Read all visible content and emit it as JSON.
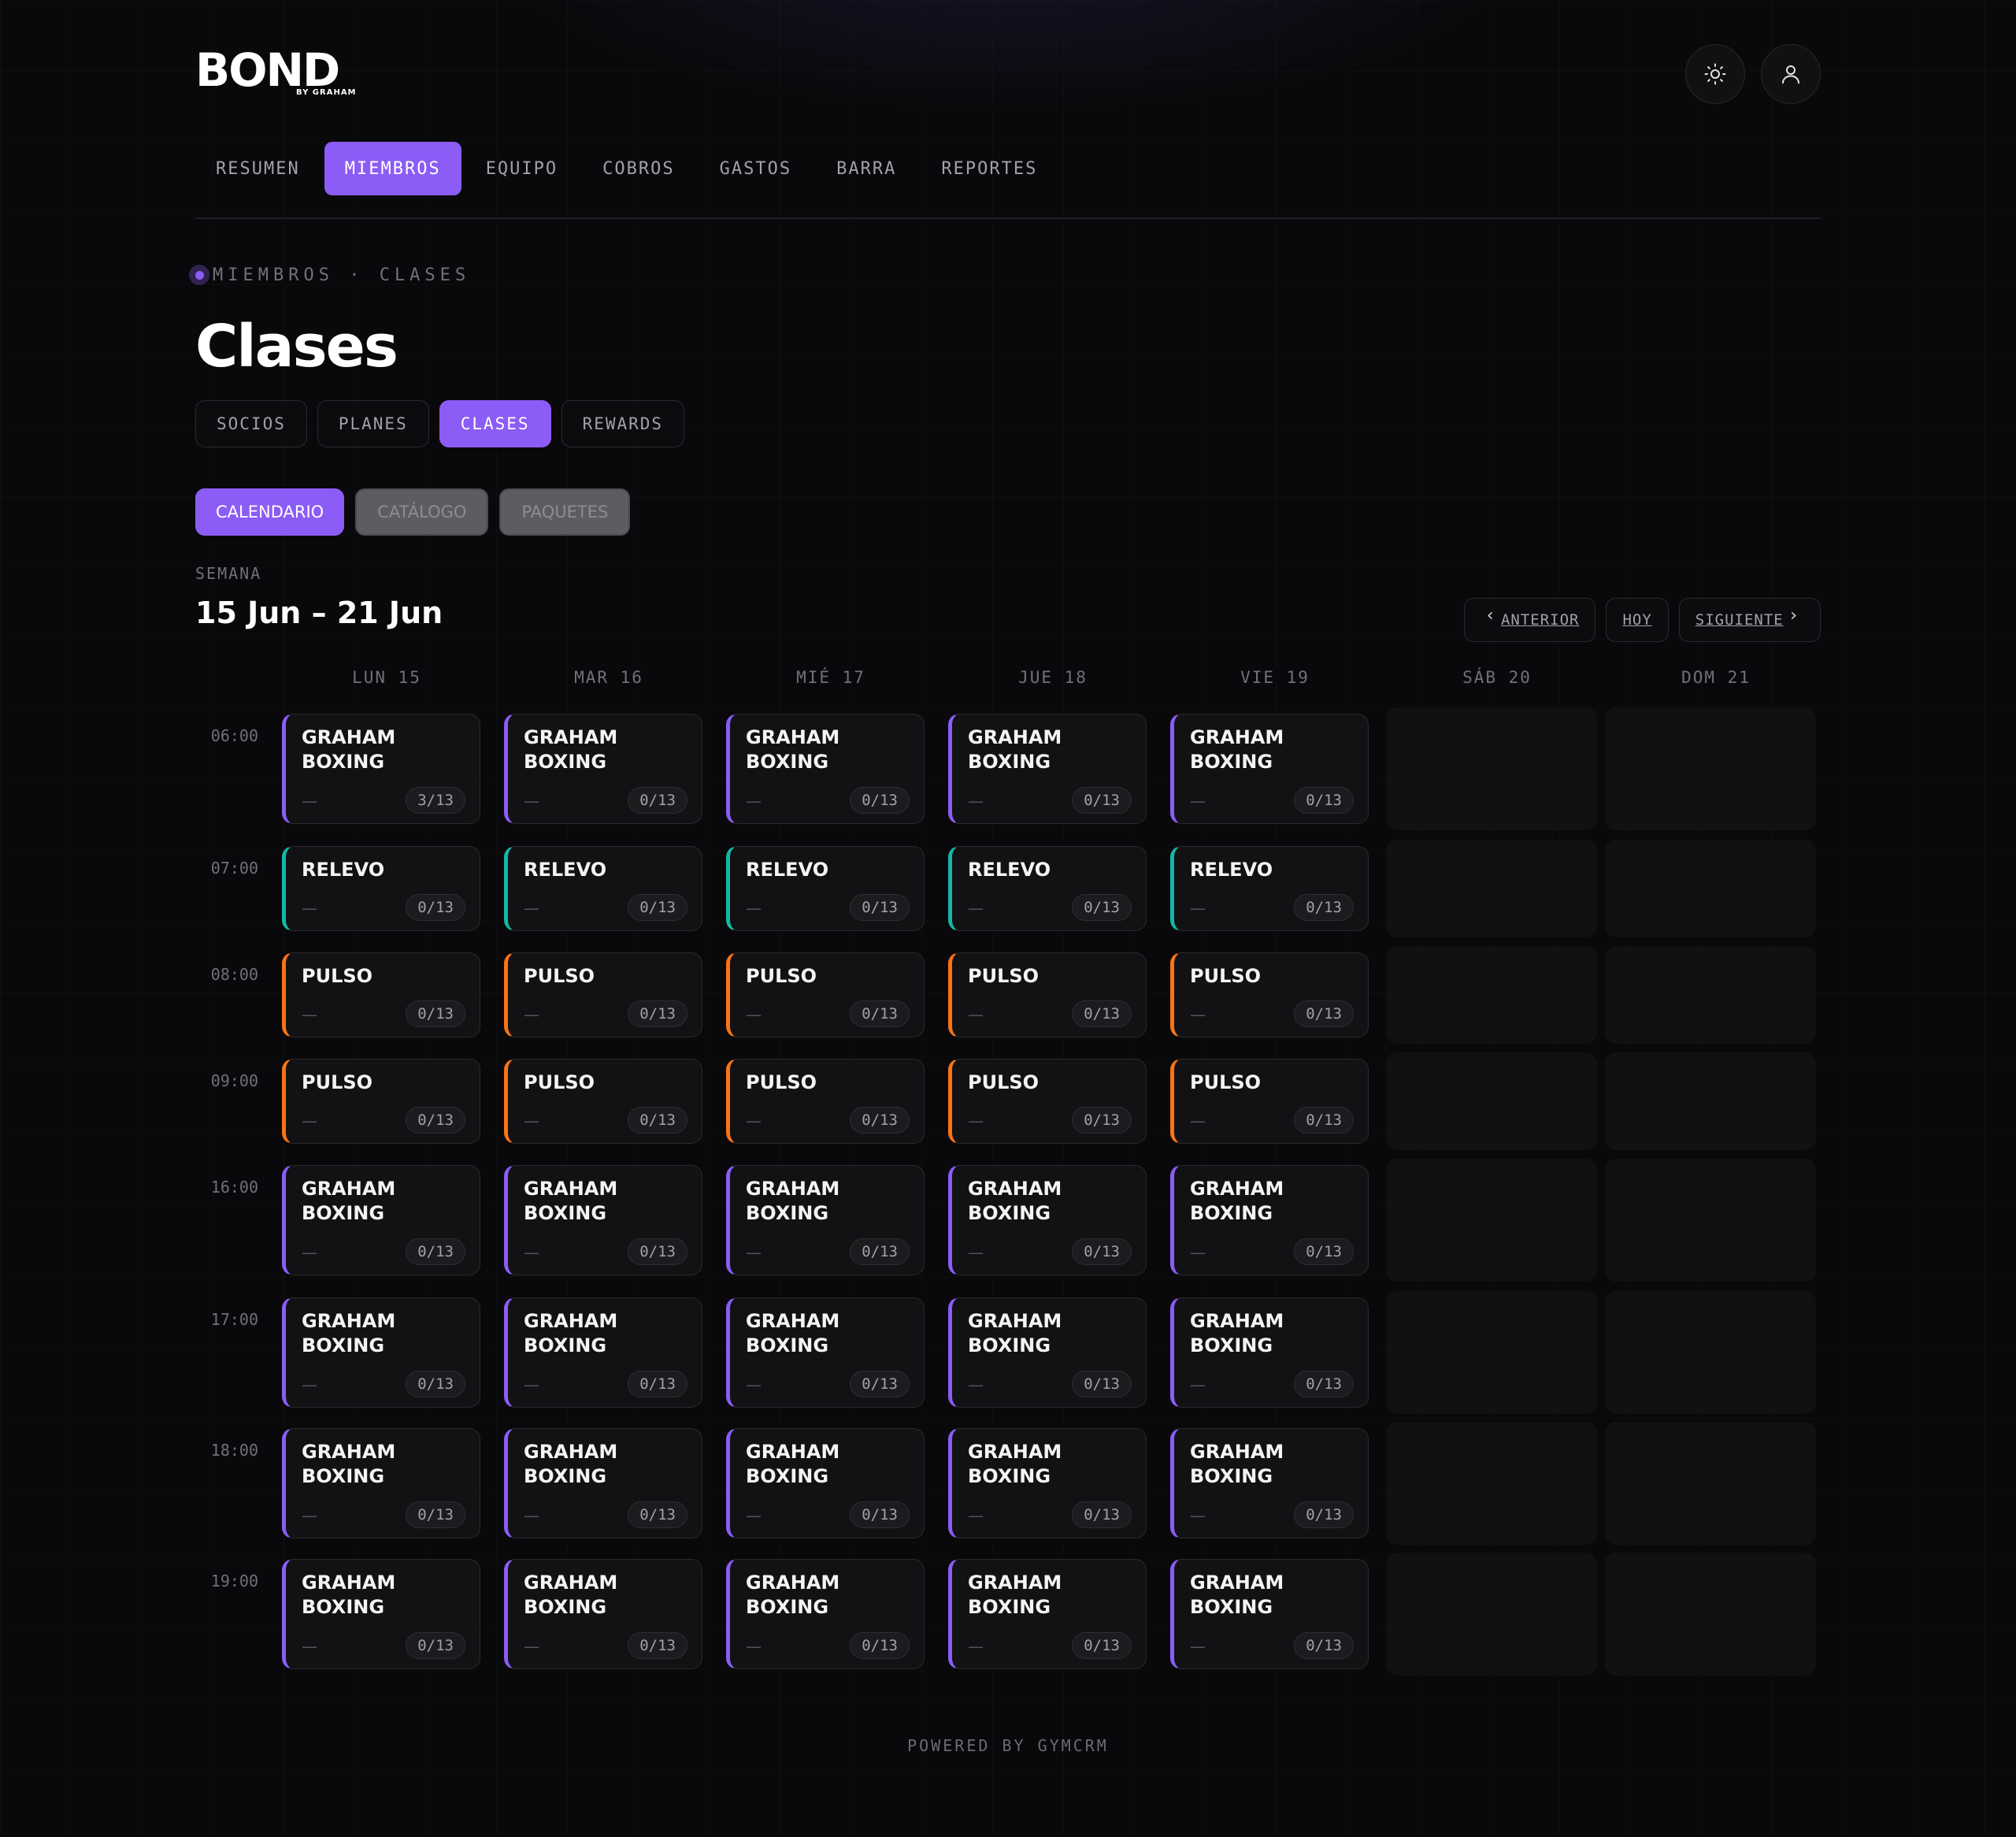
{
  "brand": {
    "name": "BOND",
    "sub": "BY GRAHAM"
  },
  "header": {
    "theme_icon": "sun-icon",
    "user_icon": "user-icon"
  },
  "nav": {
    "items": [
      "RESUMEN",
      "MIEMBROS",
      "EQUIPO",
      "COBROS",
      "GASTOS",
      "BARRA",
      "REPORTES"
    ],
    "active": "MIEMBROS"
  },
  "breadcrumb": "MIEMBROS · CLASES",
  "page_title": "Clases",
  "tabs": {
    "items": [
      "SOCIOS",
      "PLANES",
      "CLASES",
      "REWARDS"
    ],
    "active": "CLASES"
  },
  "subtabs": {
    "items": [
      "CALENDARIO",
      "CATÁLOGO",
      "PAQUETES"
    ],
    "active": "CALENDARIO"
  },
  "week": {
    "label": "SEMANA",
    "range": "15 Jun – 21 Jun",
    "prev": "ANTERIOR",
    "today": "HOY",
    "next": "SIGUIENTE"
  },
  "calendar": {
    "days": [
      "LUN 15",
      "MAR 16",
      "MIÉ 17",
      "JUE 18",
      "VIE 19",
      "SÁB 20",
      "DOM 21"
    ],
    "times": [
      "06:00",
      "07:00",
      "08:00",
      "09:00",
      "16:00",
      "17:00",
      "18:00",
      "19:00"
    ],
    "class_types": {
      "boxing": {
        "name": "GRAHAM BOXING",
        "color": "#8b5cf6"
      },
      "relevo": {
        "name": "RELEVO",
        "color": "#14b8a6"
      },
      "pulso": {
        "name": "PULSO",
        "color": "#f97316"
      }
    },
    "rows": [
      {
        "type": "boxing",
        "instructor": "—",
        "caps": [
          "3/13",
          "0/13",
          "0/13",
          "0/13",
          "0/13"
        ]
      },
      {
        "type": "relevo",
        "instructor": "—",
        "caps": [
          "0/13",
          "0/13",
          "0/13",
          "0/13",
          "0/13"
        ]
      },
      {
        "type": "pulso",
        "instructor": "—",
        "caps": [
          "0/13",
          "0/13",
          "0/13",
          "0/13",
          "0/13"
        ]
      },
      {
        "type": "pulso",
        "instructor": "—",
        "caps": [
          "0/13",
          "0/13",
          "0/13",
          "0/13",
          "0/13"
        ]
      },
      {
        "type": "boxing",
        "instructor": "—",
        "caps": [
          "0/13",
          "0/13",
          "0/13",
          "0/13",
          "0/13"
        ]
      },
      {
        "type": "boxing",
        "instructor": "—",
        "caps": [
          "0/13",
          "0/13",
          "0/13",
          "0/13",
          "0/13"
        ]
      },
      {
        "type": "boxing",
        "instructor": "—",
        "caps": [
          "0/13",
          "0/13",
          "0/13",
          "0/13",
          "0/13"
        ]
      },
      {
        "type": "boxing",
        "instructor": "—",
        "caps": [
          "0/13",
          "0/13",
          "0/13",
          "0/13",
          "0/13"
        ]
      }
    ]
  },
  "footer": "POWERED BY GYMCRM"
}
